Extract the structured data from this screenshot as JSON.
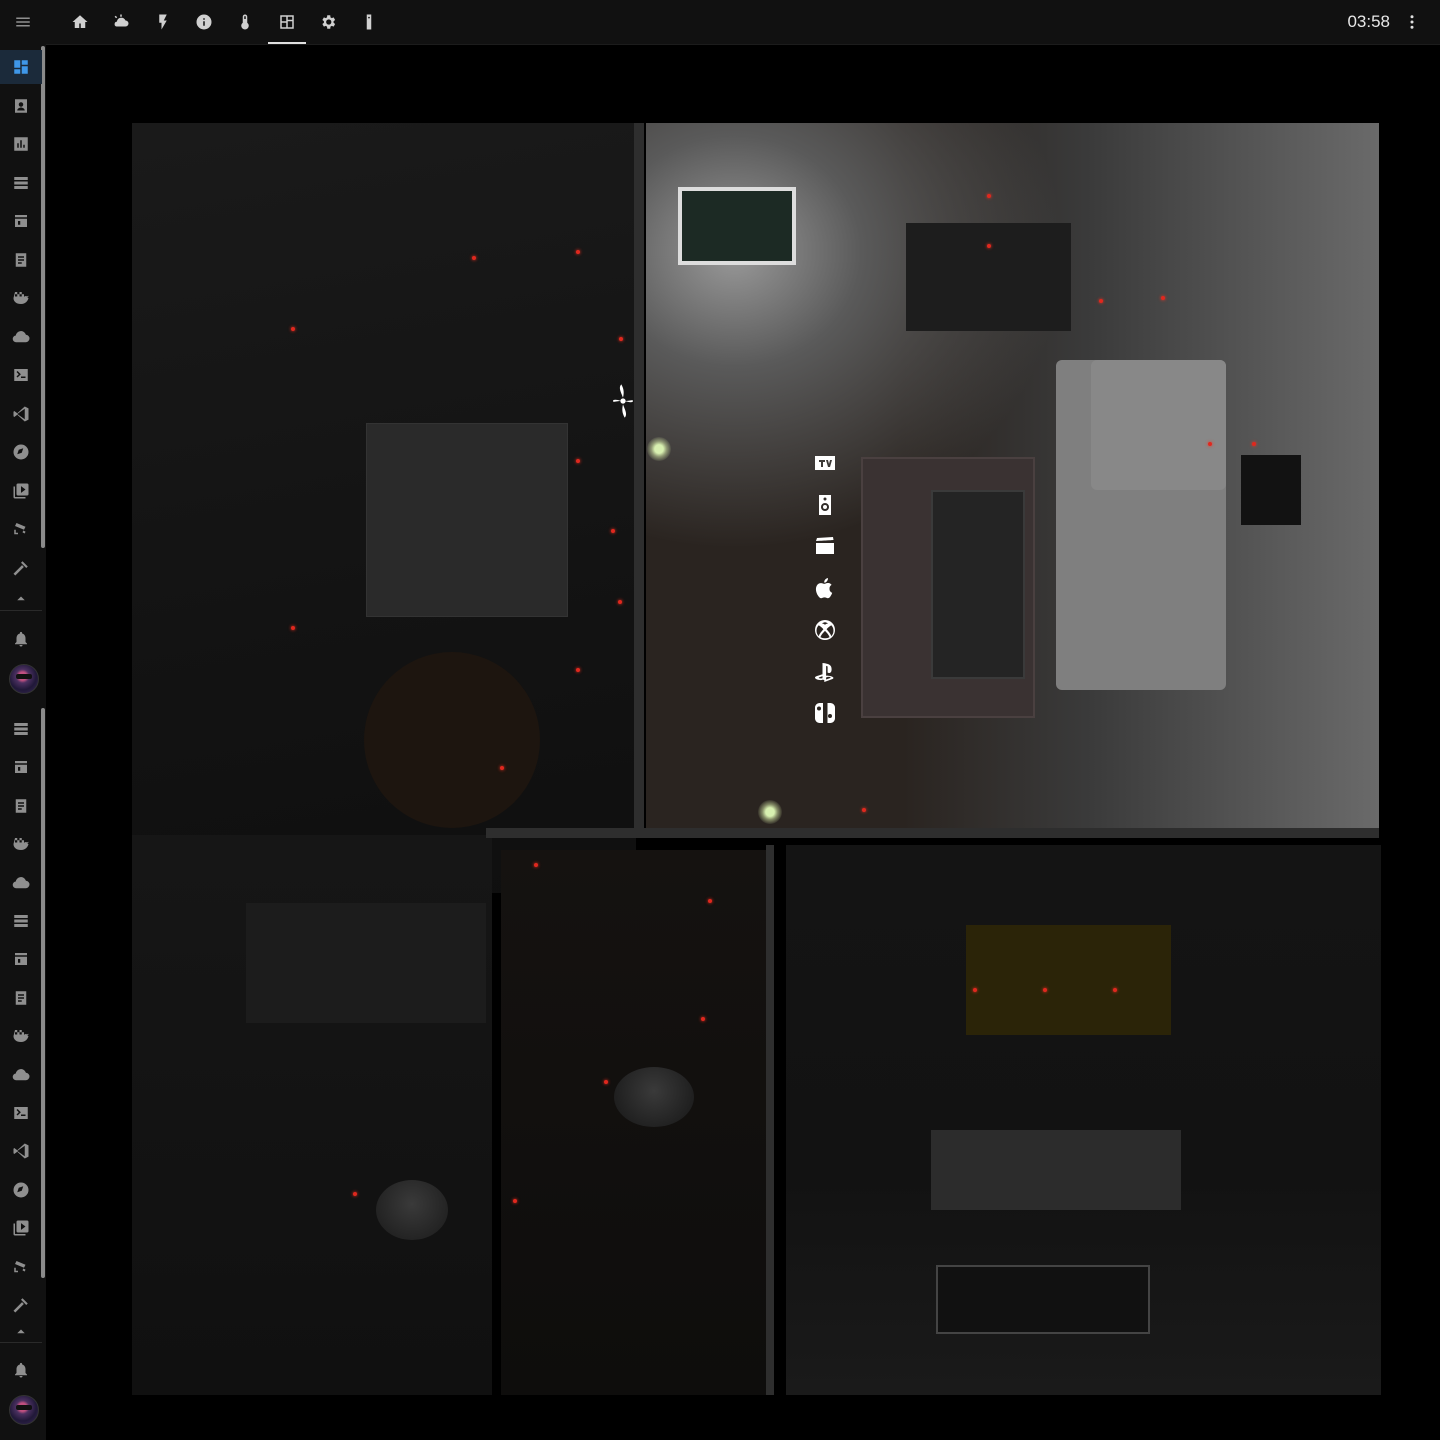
{
  "header": {
    "clock": "03:58",
    "tabs": [
      {
        "icon": "home-icon",
        "title": ""
      },
      {
        "icon": "weather-icon",
        "title": ""
      },
      {
        "icon": "energy-icon",
        "title": ""
      },
      {
        "icon": "info-icon",
        "title": ""
      },
      {
        "icon": "thermometer-icon",
        "title": ""
      },
      {
        "icon": "floorplan-icon",
        "title": "",
        "active": true
      },
      {
        "icon": "settings-icon",
        "title": ""
      },
      {
        "icon": "remote-icon",
        "title": ""
      }
    ]
  },
  "sidebar": {
    "groups": [
      {
        "items": [
          "dashboard-icon",
          "person-icon",
          "chart-icon",
          "server-icon",
          "store-icon",
          "log-icon",
          "docker-icon",
          "cloud-icon",
          "terminal-icon",
          "vscode-icon",
          "compass-icon",
          "media-icon",
          "cctv-icon",
          "hammer-icon"
        ]
      },
      {
        "items": [
          "server-icon",
          "store-icon",
          "log-icon",
          "docker-icon",
          "cloud-icon",
          "server-icon",
          "store-icon",
          "log-icon",
          "docker-icon",
          "cloud-icon",
          "terminal-icon",
          "vscode-icon",
          "compass-icon",
          "media-icon",
          "cctv-icon",
          "hammer-icon"
        ]
      }
    ],
    "active_item": "dashboard-icon",
    "notifications_icon": "bell-icon"
  },
  "floorplan": {
    "media_sources": [
      {
        "icon": "tv-icon",
        "label": "TV"
      },
      {
        "icon": "speaker-icon"
      },
      {
        "icon": "movie-icon"
      },
      {
        "icon": "apple-icon"
      },
      {
        "icon": "xbox-icon"
      },
      {
        "icon": "playstation-icon"
      },
      {
        "icon": "switch-icon"
      }
    ],
    "fan_icon": "fan-icon",
    "lights_on_color": "#d8f0b0",
    "sensor_color": "#e0281e"
  },
  "colors": {
    "background": "#000000",
    "toolbar": "#111111",
    "accent": "#3f97e8"
  }
}
